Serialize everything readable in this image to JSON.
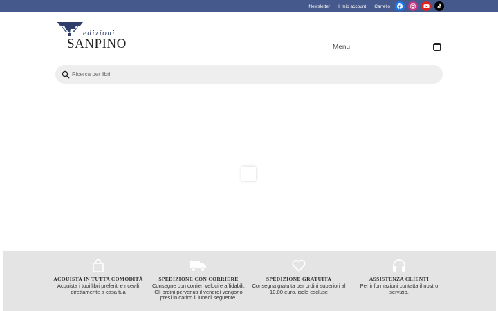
{
  "topbar": {
    "links": [
      "Newsletter",
      "Il mio account",
      "Carrello"
    ],
    "social": [
      {
        "icon": "facebook-icon",
        "color": "#1877f2"
      },
      {
        "icon": "instagram-icon",
        "color": "#c13584"
      },
      {
        "icon": "youtube-icon",
        "color": "#e62117"
      },
      {
        "icon": "tiktok-icon",
        "color": "#000000"
      }
    ]
  },
  "logo": {
    "line1": "edizioni",
    "line2": "SANPINO",
    "color": "#2e3d6b"
  },
  "header": {
    "menu_label": "Menu"
  },
  "search": {
    "placeholder": "Ricerca per libri"
  },
  "features": [
    {
      "icon": "shopping-bag-icon",
      "title": "ACQUISTA IN TUTTA COMODITÀ",
      "text": "Acquista i tuoi libri preferiti e ricevili direttamente a casa tua"
    },
    {
      "icon": "truck-icon",
      "title": "SPEDIZIONE CON CORRIERE",
      "text": "Consegne con corrieri veloci e affidabili. Gli ordini pervenuti il venerdì vengono presi in carico il lunedì seguente."
    },
    {
      "icon": "heart-icon",
      "title": "SPEDIZIONE GRATUITA",
      "text": "Consegna gratuita per ordini superiori al 10,00 euro, isole escluse"
    },
    {
      "icon": "headphones-icon",
      "title": "ASSISTENZA CLIENTI",
      "text": "Per informazioni contatta il nostro servizio."
    }
  ]
}
